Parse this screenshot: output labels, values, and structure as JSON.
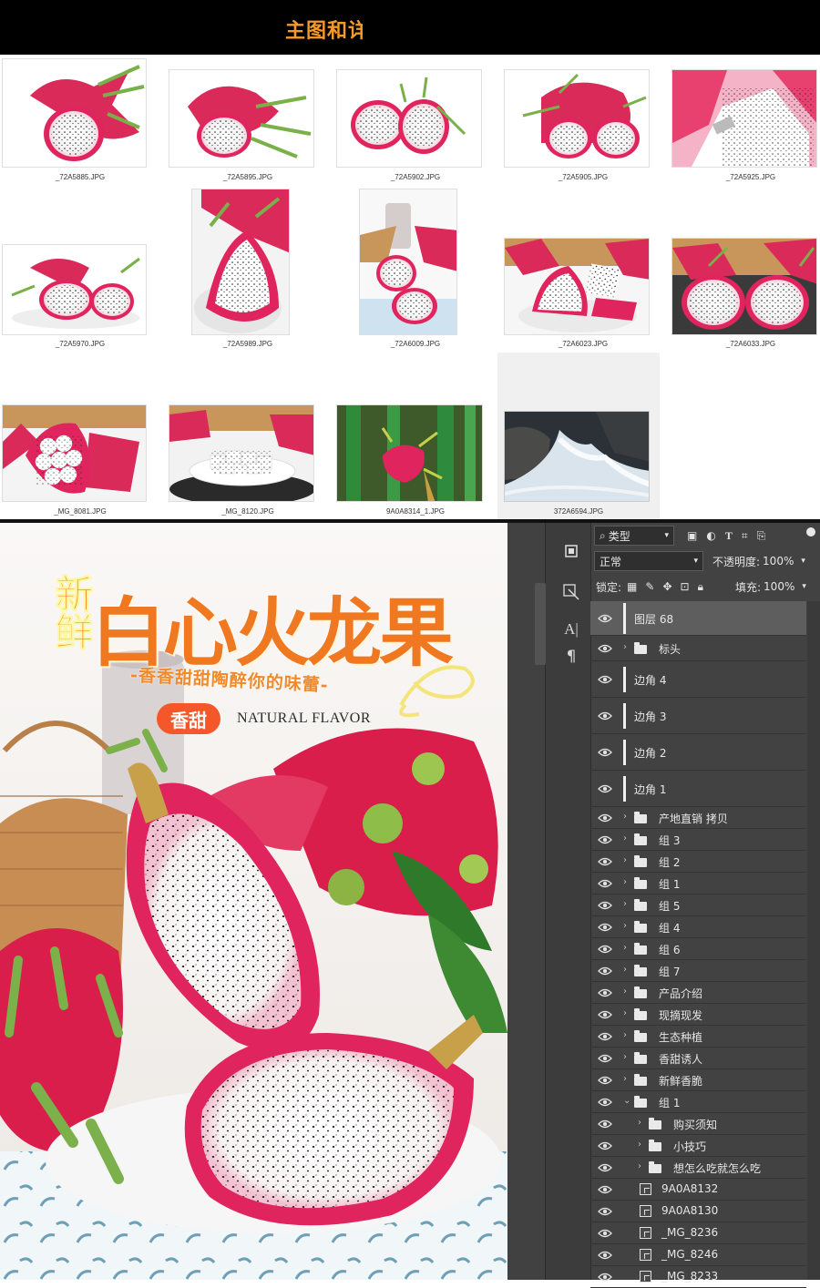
{
  "header": {
    "title": "主图和详"
  },
  "colors": {
    "accent": "#f39a2a",
    "pink": "#e0245e",
    "ps_panel": "#424242"
  },
  "files": [
    {
      "name": "_72A5885.JPG"
    },
    {
      "name": "_72A5895.JPG"
    },
    {
      "name": "_72A5902.JPG"
    },
    {
      "name": "_72A5905.JPG"
    },
    {
      "name": "_72A5925.JPG"
    },
    {
      "name": "_72A5970.JPG"
    },
    {
      "name": "_72A5989.JPG"
    },
    {
      "name": "_72A6009.JPG"
    },
    {
      "name": "_72A6023.JPG"
    },
    {
      "name": "_72A6033.JPG"
    },
    {
      "name": "_MG_8081.JPG"
    },
    {
      "name": "_MG_8120.JPG"
    },
    {
      "name": "9A0A8314_1.JPG"
    },
    {
      "name": "372A6594.JPG"
    }
  ],
  "poster": {
    "badge": "新鲜",
    "title": "白心火龙果",
    "slogan": "-香香甜甜陶醉你的味蕾-",
    "tag": "香甜",
    "english": "NATURAL FLAVOR"
  },
  "ps": {
    "filter_kind": "类型",
    "blend_mode": "正常",
    "opacity_label": "不透明度:",
    "opacity_value": "100%",
    "lock_label": "锁定:",
    "fill_label": "填充:",
    "fill_value": "100%",
    "layers": [
      {
        "name": "图层 68"
      },
      {
        "name": "标头"
      },
      {
        "name": "边角 4"
      },
      {
        "name": "边角 3"
      },
      {
        "name": "边角 2"
      },
      {
        "name": "边角 1"
      },
      {
        "name": "产地直销 拷贝"
      },
      {
        "name": "组 3"
      },
      {
        "name": "组 2"
      },
      {
        "name": "组 1"
      },
      {
        "name": "组 5"
      },
      {
        "name": "组 4"
      },
      {
        "name": "组 6"
      },
      {
        "name": "组 7"
      },
      {
        "name": "产品介绍"
      },
      {
        "name": "现摘现发"
      },
      {
        "name": "生态种植"
      },
      {
        "name": "香甜诱人"
      },
      {
        "name": "新鲜香脆"
      },
      {
        "name": "组 1"
      },
      {
        "name": "购买须知"
      },
      {
        "name": "小技巧"
      },
      {
        "name": "想怎么吃就怎么吃"
      },
      {
        "name": "9A0A8132"
      },
      {
        "name": "9A0A8130"
      },
      {
        "name": "_MG_8236"
      },
      {
        "name": "_MG_8246"
      },
      {
        "name": "_MG_8233"
      }
    ]
  }
}
